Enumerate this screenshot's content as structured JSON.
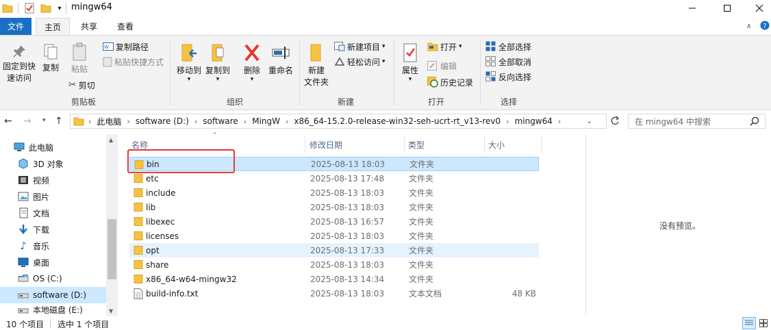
{
  "window": {
    "title": "mingw64"
  },
  "tabs": [
    {
      "label": "文件"
    },
    {
      "label": "主页"
    },
    {
      "label": "共享"
    },
    {
      "label": "查看"
    }
  ],
  "ribbon": {
    "clipboard": {
      "pin": "固定到快\n速访问",
      "copy": "复制",
      "paste": "粘贴",
      "copy_path": "复制路径",
      "paste_shortcut": "粘贴快捷方式",
      "cut": "剪切",
      "group": "剪贴板"
    },
    "organize": {
      "move_to": "移动到",
      "copy_to": "复制到",
      "delete": "删除",
      "rename": "重命名",
      "group": "组织"
    },
    "new": {
      "new_folder": "新建\n文件夹",
      "new_item": "新建项目",
      "easy_access": "轻松访问",
      "group": "新建"
    },
    "open": {
      "properties": "属性",
      "open": "打开",
      "edit": "编辑",
      "history": "历史记录",
      "group": "打开"
    },
    "select": {
      "select_all": "全部选择",
      "select_none": "全部取消",
      "invert": "反向选择",
      "group": "选择"
    }
  },
  "address": {
    "crumbs": [
      "此电脑",
      "software (D:)",
      "software",
      "MingW",
      "x86_64-15.2.0-release-win32-seh-ucrt-rt_v13-rev0",
      "mingw64"
    ],
    "search_placeholder": "在 mingw64 中搜索"
  },
  "nav": [
    {
      "label": "此电脑",
      "icon": "pc-icon"
    },
    {
      "label": "3D 对象",
      "icon": "3d-objects-icon"
    },
    {
      "label": "视频",
      "icon": "video-icon"
    },
    {
      "label": "图片",
      "icon": "pictures-icon"
    },
    {
      "label": "文档",
      "icon": "documents-icon"
    },
    {
      "label": "下载",
      "icon": "download-icon"
    },
    {
      "label": "音乐",
      "icon": "music-icon"
    },
    {
      "label": "桌面",
      "icon": "desktop-icon"
    },
    {
      "label": "OS (C:)",
      "icon": "drive-icon"
    },
    {
      "label": "software (D:)",
      "icon": "drive-icon"
    },
    {
      "label": "本地磁盘 (E:)",
      "icon": "drive-icon"
    }
  ],
  "columns": {
    "name": "名称",
    "date": "修改日期",
    "type": "类型",
    "size": "大小"
  },
  "files": [
    {
      "name": "bin",
      "date": "2025-08-13 18:03",
      "type": "文件夹",
      "size": ""
    },
    {
      "name": "etc",
      "date": "2025-08-13 17:48",
      "type": "文件夹",
      "size": ""
    },
    {
      "name": "include",
      "date": "2025-08-13 18:03",
      "type": "文件夹",
      "size": ""
    },
    {
      "name": "lib",
      "date": "2025-08-13 18:03",
      "type": "文件夹",
      "size": ""
    },
    {
      "name": "libexec",
      "date": "2025-08-13 16:57",
      "type": "文件夹",
      "size": ""
    },
    {
      "name": "licenses",
      "date": "2025-08-13 18:03",
      "type": "文件夹",
      "size": ""
    },
    {
      "name": "opt",
      "date": "2025-08-13 17:33",
      "type": "文件夹",
      "size": ""
    },
    {
      "name": "share",
      "date": "2025-08-13 18:03",
      "type": "文件夹",
      "size": ""
    },
    {
      "name": "x86_64-w64-mingw32",
      "date": "2025-08-13 14:34",
      "type": "文件夹",
      "size": ""
    },
    {
      "name": "build-info.txt",
      "date": "2025-08-13 18:03",
      "type": "文本文档",
      "size": "48 KB"
    }
  ],
  "preview": {
    "empty_text": "没有预览。"
  },
  "status": {
    "item_count": "10 个项目",
    "selected": "选中 1 个项目"
  },
  "colors": {
    "accent": "#1a6fc4",
    "selection": "#cce8ff",
    "highlight_box": "#e53935",
    "folder": "#f5c244"
  }
}
